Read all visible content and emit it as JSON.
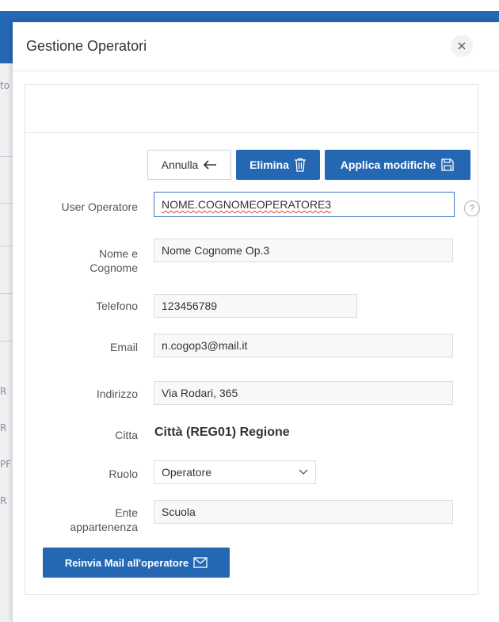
{
  "modal": {
    "title": "Gestione Operatori",
    "close_glyph": "×"
  },
  "buttons": {
    "cancel": "Annulla",
    "delete": "Elimina",
    "apply": "Applica modifiche",
    "resend_mail": "Reinvia Mail all'operatore"
  },
  "fields": {
    "user": {
      "label": "User Operatore",
      "value": "NOME.COGNOMEOPERATORE3"
    },
    "name": {
      "label_line1": "Nome e",
      "label_line2": "Cognome",
      "value": "Nome Cognome Op.3"
    },
    "phone": {
      "label": "Telefono",
      "value": "123456789"
    },
    "email": {
      "label": "Email",
      "value": "n.cogop3@mail.it"
    },
    "address": {
      "label": "Indirizzo",
      "value": "Via Rodari, 365"
    },
    "city": {
      "label": "Citta",
      "value": "Città (REG01) Regione"
    },
    "role": {
      "label": "Ruolo",
      "value": "Operatore"
    },
    "entity": {
      "label_line1": "Ente",
      "label_line2": "appartenenza",
      "value": "Scuola"
    }
  },
  "help_glyph": "?",
  "background": {
    "left_chars": [
      "to",
      "R",
      "R",
      "PF",
      "R"
    ]
  },
  "icons": {
    "arrow_left": "arrow-left-icon",
    "trash": "trash-icon",
    "save": "save-icon",
    "mail": "mail-icon",
    "chevron": "chevron-down-icon",
    "help": "help-icon",
    "close": "close-icon"
  },
  "colors": {
    "primary": "#2468b3",
    "active_border": "#3c78c3",
    "spellcheck": "#d9423a"
  }
}
